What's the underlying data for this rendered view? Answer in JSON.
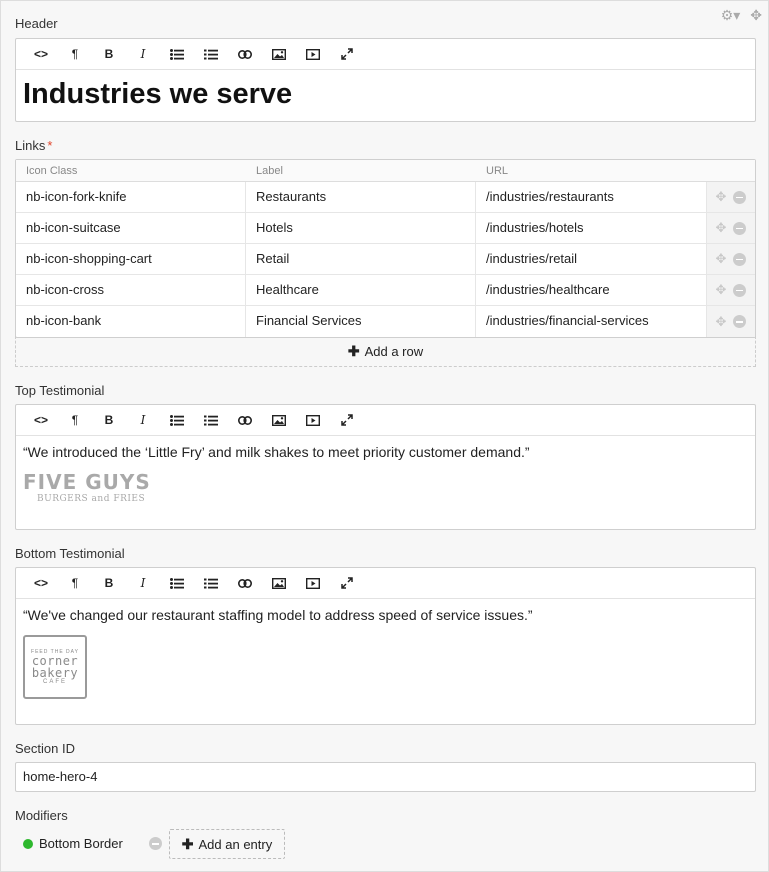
{
  "header": {
    "label": "Header",
    "content": "Industries we serve"
  },
  "links": {
    "label": "Links",
    "required_mark": "*",
    "columns": [
      "Icon Class",
      "Label",
      "URL"
    ],
    "rows": [
      [
        "nb-icon-fork-knife",
        "Restaurants",
        "/industries/restaurants"
      ],
      [
        "nb-icon-suitcase",
        "Hotels",
        "/industries/hotels"
      ],
      [
        "nb-icon-shopping-cart",
        "Retail",
        "/industries/retail"
      ],
      [
        "nb-icon-cross",
        "Healthcare",
        "/industries/healthcare"
      ],
      [
        "nb-icon-bank",
        "Financial Services",
        "/industries/financial-services"
      ]
    ],
    "add_row_label": "Add a row"
  },
  "top_testimonial": {
    "label": "Top Testimonial",
    "quote": "“We introduced the ‘Little Fry’ and milk shakes to meet priority customer demand.”",
    "logo_main": "FIVE GUYS",
    "logo_sub": "BURGERS and FRIES"
  },
  "bottom_testimonial": {
    "label": "Bottom Testimonial",
    "quote": "“We've changed our restaurant staffing model to address speed of service issues.”",
    "logo_top": "FEED THE DAY",
    "logo_line1": "corner",
    "logo_line2": "bakery",
    "logo_bottom": "CAFE"
  },
  "section_id": {
    "label": "Section ID",
    "value": "home-hero-4"
  },
  "modifiers": {
    "label": "Modifiers",
    "entries": [
      "Bottom Border"
    ],
    "entry_color": "#2eb82e",
    "add_entry_label": "Add an entry"
  },
  "toolbar_icons": [
    "code-icon",
    "paragraph-icon",
    "bold-icon",
    "italic-icon",
    "bullet-list-icon",
    "numbered-list-icon",
    "link-icon",
    "image-icon",
    "video-icon",
    "fullscreen-icon"
  ],
  "toolbar_glyphs": {
    "code": "<>",
    "paragraph": "¶",
    "bold": "B",
    "italic": "I"
  }
}
